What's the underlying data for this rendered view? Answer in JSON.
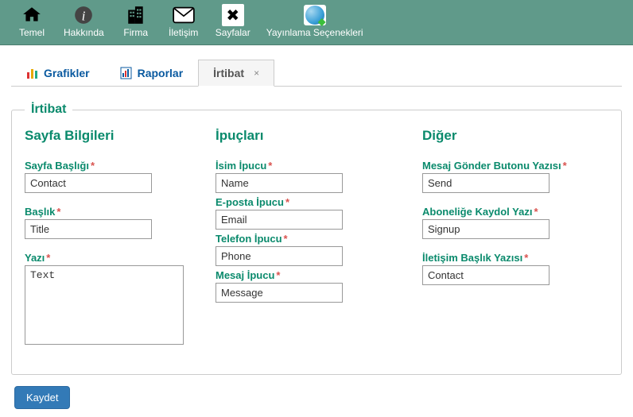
{
  "topbar": [
    {
      "name": "temel",
      "label": "Temel",
      "icon": "home"
    },
    {
      "name": "hakkinda",
      "label": "Hakkında",
      "icon": "info"
    },
    {
      "name": "firma",
      "label": "Firma",
      "icon": "buildings"
    },
    {
      "name": "iletisim",
      "label": "İletişim",
      "icon": "mail"
    },
    {
      "name": "sayfalar",
      "label": "Sayfalar",
      "icon": "tools"
    },
    {
      "name": "yayin",
      "label": "Yayınlama Seçenekleri",
      "icon": "globe"
    }
  ],
  "tabs": {
    "grafikler": "Grafikler",
    "raporlar": "Raporlar",
    "irtibat": "İrtibat"
  },
  "fieldset_title": "İrtibat",
  "sections": {
    "sayfa": {
      "title": "Sayfa Bilgileri",
      "sayfa_basligi": {
        "label": "Sayfa Başlığı",
        "value": "Contact"
      },
      "baslik": {
        "label": "Başlık",
        "value": "Title"
      },
      "yazi": {
        "label": "Yazı",
        "value": "Text"
      }
    },
    "ipuclari": {
      "title": "İpuçları",
      "isim": {
        "label": "İsim İpucu",
        "value": "Name"
      },
      "eposta": {
        "label": "E-posta İpucu",
        "value": "Email"
      },
      "telefon": {
        "label": "Telefon İpucu",
        "value": "Phone"
      },
      "mesaj": {
        "label": "Mesaj İpucu",
        "value": "Message"
      }
    },
    "diger": {
      "title": "Diğer",
      "gonder": {
        "label": "Mesaj Gönder Butonu Yazısı",
        "value": "Send"
      },
      "abone": {
        "label": "Aboneliğe Kaydol Yazı",
        "value": "Signup"
      },
      "iletisim_baslik": {
        "label": "İletişim Başlık Yazısı",
        "value": "Contact"
      }
    }
  },
  "buttons": {
    "save": "Kaydet"
  },
  "close_x": "×"
}
